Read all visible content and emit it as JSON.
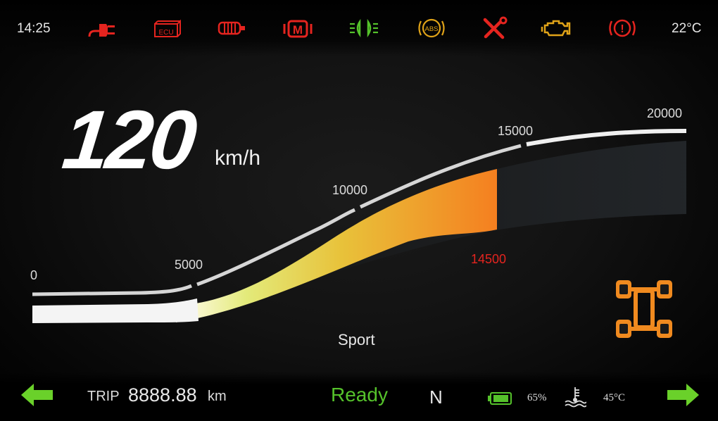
{
  "status": {
    "time": "14:25",
    "outside_temp": "22°C"
  },
  "warning_icons": [
    {
      "name": "charging-plug-icon",
      "color": "#e5241f"
    },
    {
      "name": "ecu-icon",
      "label": "ECU",
      "color": "#e5241f"
    },
    {
      "name": "motor-heater-icon",
      "color": "#e5241f"
    },
    {
      "name": "motor-fault-icon",
      "label": "M",
      "color": "#e5241f"
    },
    {
      "name": "side-lights-icon",
      "color": "#55c22b"
    },
    {
      "name": "abs-icon",
      "label": "ABS",
      "color": "#e0a318"
    },
    {
      "name": "service-tools-icon",
      "color": "#e5241f"
    },
    {
      "name": "check-engine-icon",
      "color": "#e0a318"
    },
    {
      "name": "brake-warning-icon",
      "label": "!",
      "color": "#e5241f"
    }
  ],
  "speed": {
    "value": "120",
    "unit": "km/h"
  },
  "rpm_scale": {
    "max": 20000,
    "current": 14500,
    "current_label": "14500",
    "ticks": [
      "0",
      "5000",
      "10000",
      "15000",
      "20000"
    ]
  },
  "drive_mode": "Sport",
  "drivetrain_icon": {
    "name": "awd-drivetrain-icon",
    "color": "#f08a1f"
  },
  "bottom": {
    "trip_label": "TRIP",
    "trip_value": "8888.88",
    "trip_unit": "km",
    "ready": "Ready",
    "gear": "N",
    "battery_percent": "65%",
    "coolant_temp": "45°C"
  },
  "colors": {
    "turn_signal": "#6ad12a",
    "accent_red": "#e5241f",
    "accent_orange": "#f08a1f",
    "accent_green": "#55c22b"
  }
}
